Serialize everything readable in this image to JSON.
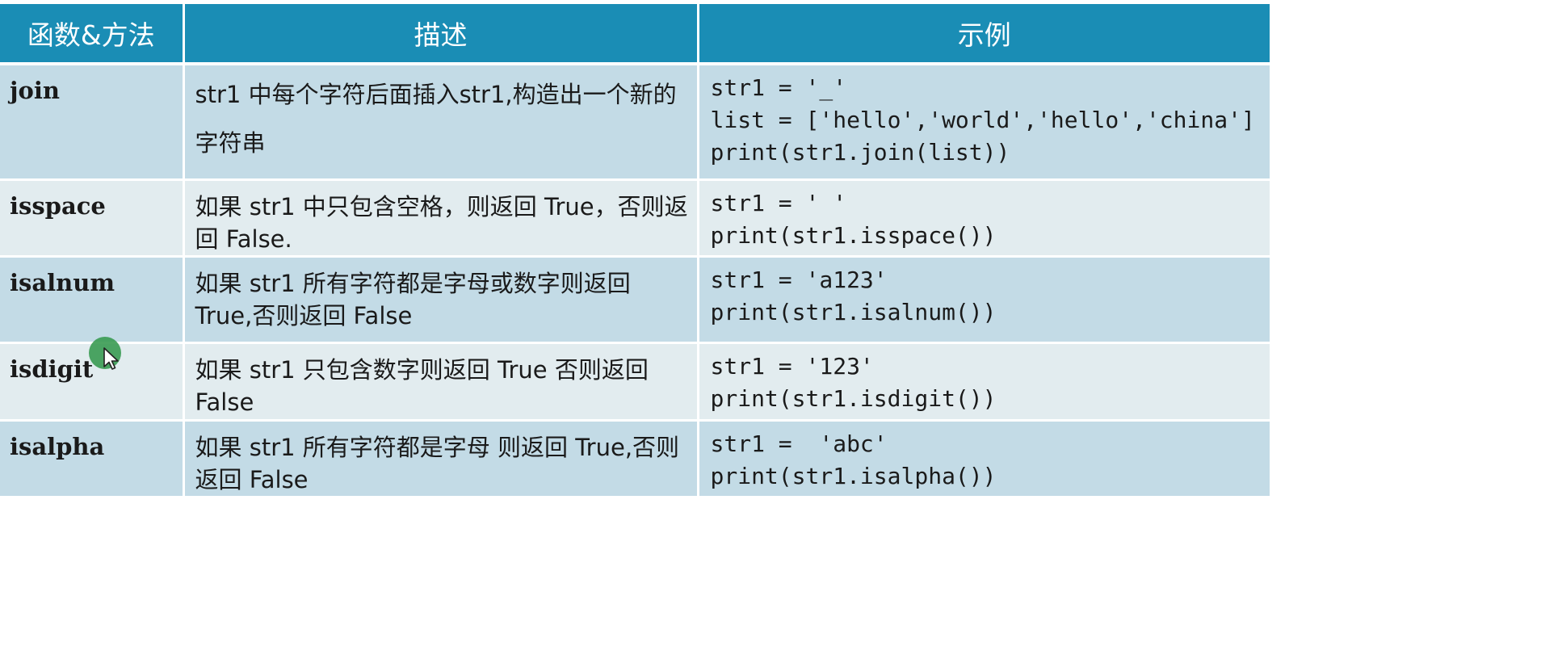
{
  "table": {
    "headers": [
      "函数&方法",
      "描述",
      "示例"
    ],
    "header_color": "#1a8db5",
    "row_colors": [
      "#c3dbe6",
      "#e2ecef"
    ],
    "rows": [
      {
        "name": "join",
        "description": "str1 中每个字符后面插入str1,构造出一个新的字符串",
        "example": [
          "str1 = '_'",
          "list = ['hello','world','hello','china']",
          "print(str1.join(list))"
        ]
      },
      {
        "name": "isspace",
        "description": "如果 str1 中只包含空格，则返回 True，否则返回 False.",
        "example": [
          "str1 = ' '",
          "print(str1.isspace())"
        ]
      },
      {
        "name": "isalnum",
        "description": "如果 str1 所有字符都是字母或数字则返回 True,否则返回 False",
        "example": [
          "str1 = 'a123'",
          "print(str1.isalnum())"
        ]
      },
      {
        "name": "isdigit",
        "description": "如果 str1 只包含数字则返回 True 否则返回 False",
        "example": [
          "str1 = '123'",
          "print(str1.isdigit())"
        ]
      },
      {
        "name": "isalpha",
        "description": "如果 str1 所有字符都是字母 则返回 True,否则返回 False",
        "example": [
          "str1 =  'abc'",
          "print(str1.isalpha())"
        ]
      }
    ]
  },
  "cursor": {
    "icon": "pointer-arrow-icon",
    "highlight_color": "#3a9b52"
  }
}
